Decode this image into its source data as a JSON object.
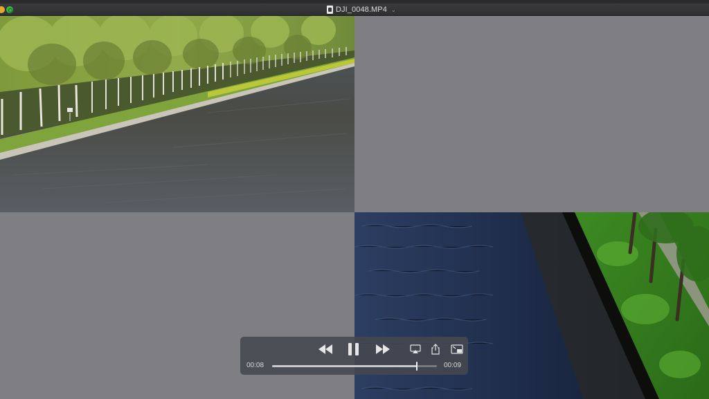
{
  "window": {
    "title": "DJI_0048.MP4",
    "title_chevron": "⌄"
  },
  "player": {
    "current_time": "00:08",
    "end_time": "00:09",
    "progress": 0.88,
    "state": "playing",
    "controls": {
      "rewind_icon": "rewind-icon",
      "pause_icon": "pause-icon",
      "fast_forward_icon": "fast-forward-icon",
      "airplay_icon": "airplay-icon",
      "share_icon": "share-icon",
      "pip_icon": "picture-in-picture-icon"
    }
  },
  "colors": {
    "video_background": "#7f7e82",
    "control_bar": "#46484e",
    "traffic_yellow": "#e3a92b",
    "traffic_green": "#36b844"
  }
}
